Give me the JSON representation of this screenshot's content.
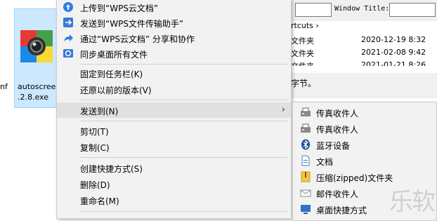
{
  "desktop": {
    "file_name": "autoscree….2.8.exe",
    "file_name_line1": "autoscree",
    "file_name_line2": ".2.8.exe",
    "left_clip": "nf"
  },
  "bg_window": {
    "window_title_label": "Window Title:",
    "path_fragment": "rtcuts ›",
    "rows": [
      {
        "type": "文件夹",
        "date": "2020-12-19 8:32"
      },
      {
        "type": "文件夹",
        "date": "2021-02-08 9:42"
      },
      {
        "type": "文件夹",
        "date": "2021-01-21 8:26"
      }
    ],
    "status_fragment": "字节。"
  },
  "menu": {
    "items": [
      {
        "label": "上传到“WPS云文档”",
        "icon": "cloud-upload-icon"
      },
      {
        "label": "发送到“WPS文件传输助手”",
        "icon": "wps-transfer-icon"
      },
      {
        "label": "通过“WPS云文档” 分享和协作",
        "icon": "share-icon"
      },
      {
        "label": "同步桌面所有文件",
        "icon": "sync-desktop-icon"
      },
      {
        "label": "固定到任务栏(K)"
      },
      {
        "label": "还原以前的版本(V)"
      },
      {
        "label": "发送到(N)"
      },
      {
        "label": "剪切(T)"
      },
      {
        "label": "复制(C)"
      },
      {
        "label": "创建快捷方式(S)"
      },
      {
        "label": "删除(D)"
      },
      {
        "label": "重命名(M)"
      }
    ],
    "submenu_arrow": "›"
  },
  "submenu": {
    "items": [
      {
        "label": "传真收件人",
        "icon": "fax-icon"
      },
      {
        "label": "传真收件人",
        "icon": "fax-icon"
      },
      {
        "label": "蓝牙设备",
        "icon": "bluetooth-icon"
      },
      {
        "label": "文档",
        "icon": "document-icon"
      },
      {
        "label": "压缩(zipped)文件夹",
        "icon": "zip-folder-icon"
      },
      {
        "label": "邮件收件人",
        "icon": "mail-icon"
      },
      {
        "label": "桌面快捷方式",
        "icon": "desktop-icon"
      }
    ]
  },
  "watermark": "乐软"
}
